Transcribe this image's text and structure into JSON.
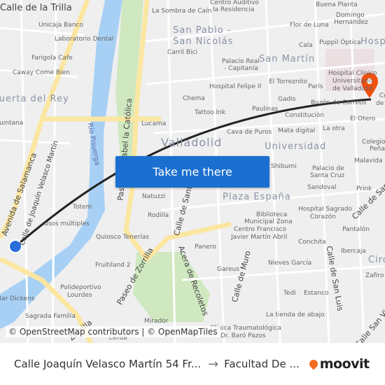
{
  "map": {
    "districts": [
      "San Pablo -",
      "San Nicolás",
      "San Martín",
      "Huerta del Rey",
      "Universidad",
      "Plaza España",
      "Hospital",
      "Circular"
    ],
    "city": "Valladolid",
    "streets": [
      "Calle de la Trilla",
      "Avenida de Salamanca",
      "Calle de Joaquín Velasco Martín",
      "Río Pisuerga",
      "Paseo de Isabel la Católica",
      "Calle de Santiago",
      "Paseo de Zorrilla",
      "Acera de Recoletos",
      "Calle de Muro",
      "Calle de San Luis",
      "Calle de San Ildefonso",
      "Calle San Vicente",
      "Zorrilla"
    ],
    "labels": [
      "Unicaja Banco",
      "Laboratorio Dental",
      "Farigola Cafe",
      "Caway Come Bien",
      "Quintana",
      "La Sombra de Caín",
      "Centro Auditivo",
      "la Residencia",
      "Buena Planta",
      "Domingo",
      "Hernández",
      "Flor de Luna",
      "Puppil Óptica",
      "Cala",
      "Carril Bici",
      "Palacio Real",
      "- Capitanía",
      "Hospital Felipe II",
      "El Torreznito",
      "París",
      "Hospital Clínico",
      "Universitario",
      "de Valladolid",
      "Chema",
      "Gadis",
      "Buzón de Correos",
      "Tattoo Ink",
      "Paulinas",
      "Constitución",
      "Lucama",
      "Cava de Puros",
      "Mata digital",
      "La otra",
      "El Otero",
      "Colegio",
      "Peñas",
      "Malavida",
      "Shibumi",
      "Palacio de",
      "Santa Cruz",
      "Sandoval",
      "Prink",
      "Totem",
      "usos múltiples",
      "Natuzzi",
      "Rodilla",
      "Hospital Sagrado",
      "Corazón",
      "Pantalón",
      "Biblioteca",
      "Municipal Zona",
      "Centro Francisco",
      "Javier Martín Abril",
      "Conchita",
      "Ibercaja",
      "Quiosco Tenerías",
      "Panero",
      "Zafiro",
      "Fruitiland 2",
      "Gareus",
      "Nieves García",
      "Polideportivo",
      "Lourdes",
      "Tedi",
      "Estanco",
      "Bar Dickens",
      "La tienda de abajo",
      "Sagrada Familia",
      "Mirador",
      "Clínica Traumatológica",
      "Dr. Baró Pazos",
      "Cerda",
      "Co",
      "de"
    ],
    "button_label": "Take me there",
    "attribution": "© OpenStreetMap contributors | © OpenMapTiles",
    "colors": {
      "water": "#a8d0f5",
      "park": "#cfe8c0",
      "major_road": "#fbe6a2",
      "route": "#222222",
      "origin": "#2a6fdb",
      "destination": "#f0500f",
      "button": "#1a6fd0"
    }
  },
  "footer": {
    "origin": "Calle Joaquín Velasco Martín 54 Fr...",
    "destination": "Facultad De ...",
    "brand": "moovit"
  }
}
